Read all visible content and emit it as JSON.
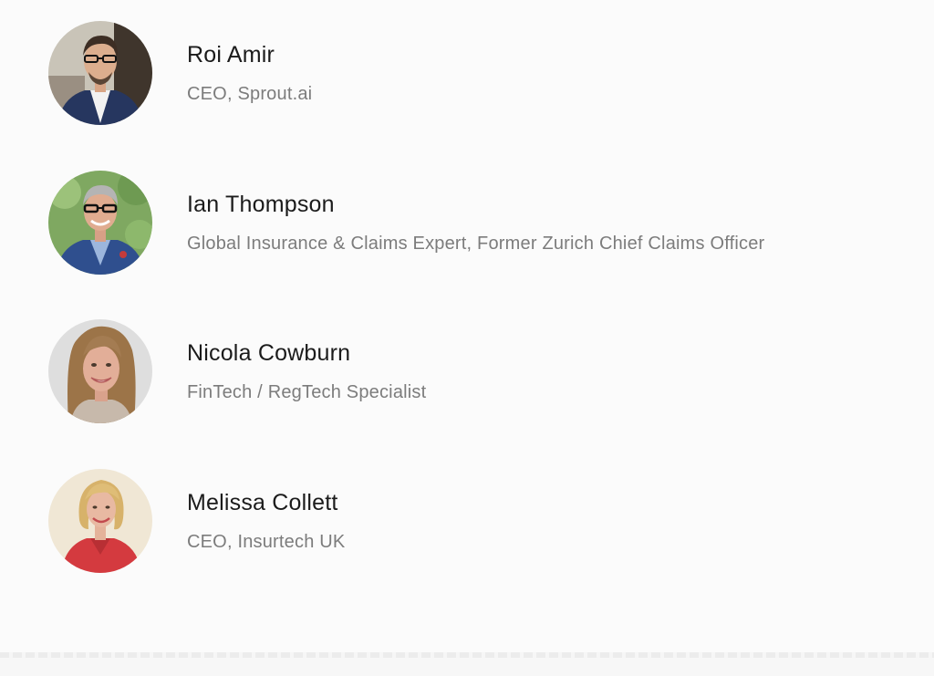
{
  "speakers": [
    {
      "name": "Roi Amir",
      "role": "CEO, Sprout.ai",
      "avatar_icon": "man-glasses-navy-blazer-portrait"
    },
    {
      "name": "Ian Thompson",
      "role": "Global Insurance & Claims Expert, Former Zurich Chief Claims Officer",
      "avatar_icon": "man-glasses-blue-suit-portrait"
    },
    {
      "name": "Nicola Cowburn",
      "role": "FinTech / RegTech Specialist",
      "avatar_icon": "woman-long-hair-portrait"
    },
    {
      "name": "Melissa Collett",
      "role": "CEO, Insurtech UK",
      "avatar_icon": "woman-blonde-red-jacket-portrait"
    }
  ],
  "colors": {
    "background": "#fbfbfb",
    "name_text": "#1b1b1b",
    "role_text": "#7c7c7c"
  }
}
